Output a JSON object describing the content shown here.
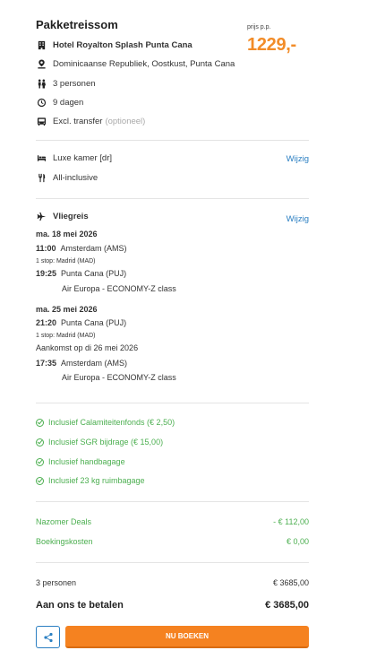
{
  "header": {
    "title": "Pakketreissom",
    "price_label": "prijs p.p.",
    "price": "1229,-"
  },
  "package": {
    "hotel": "Hotel Royalton Splash Punta Cana",
    "location": "Dominicaanse Republiek, Oostkust, Punta Cana",
    "persons": "3 personen",
    "duration": "9 dagen",
    "transfer": "Excl. transfer",
    "transfer_note": "(optioneel)"
  },
  "room": {
    "type": "Luxe kamer [dr]",
    "board": "All-inclusive",
    "change_label": "Wijzig"
  },
  "flight": {
    "heading": "Vliegreis",
    "change_label": "Wijzig",
    "outbound": {
      "date": "ma. 18 mei 2026",
      "dep_time": "11:00",
      "dep_place": "Amsterdam (AMS)",
      "stop": "1 stop: Madrid (MAD)",
      "arr_time": "19:25",
      "arr_place": "Punta Cana (PUJ)",
      "carrier": "Air Europa - ECONOMY-Z class"
    },
    "return": {
      "date": "ma. 25 mei 2026",
      "dep_time": "21:20",
      "dep_place": "Punta Cana (PUJ)",
      "stop": "1 stop: Madrid (MAD)",
      "arrival_note": "Aankomst op di 26 mei 2026",
      "arr_time": "17:35",
      "arr_place": "Amsterdam (AMS)",
      "carrier": "Air Europa - ECONOMY-Z class"
    }
  },
  "inclusions": [
    "Inclusief Calamiteitenfonds (€ 2,50)",
    "Inclusief SGR bijdrage (€ 15,00)",
    "Inclusief handbagage",
    "Inclusief 23 kg ruimbagage"
  ],
  "costs": {
    "deal_label": "Nazomer Deals",
    "deal_value": "- € 112,00",
    "booking_label": "Boekingskosten",
    "booking_value": "€ 0,00"
  },
  "totals": {
    "persons_label": "3 personen",
    "persons_value": "€ 3685,00",
    "pay_label": "Aan ons te betalen",
    "pay_value": "€ 3685,00"
  },
  "actions": {
    "book_label": "NU BOEKEN",
    "share_icon": "share-icon"
  },
  "colors": {
    "accent": "#f58220",
    "link": "#2b7fc2",
    "success": "#4caf50"
  }
}
